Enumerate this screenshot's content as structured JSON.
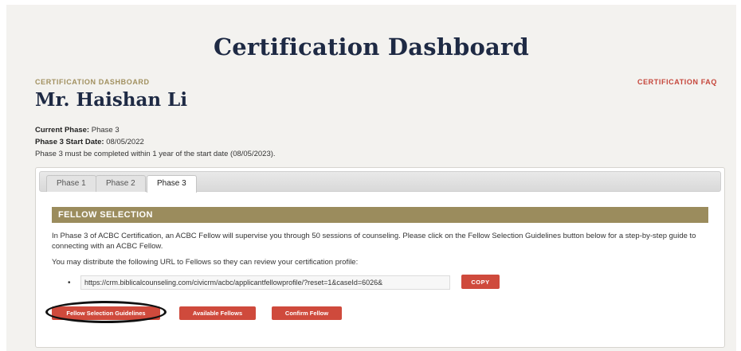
{
  "page": {
    "title": "Certification Dashboard",
    "breadcrumb": "CERTIFICATION DASHBOARD",
    "faq_link": "CERTIFICATION FAQ",
    "user_name": "Mr. Haishan Li"
  },
  "status": {
    "current_phase_label": "Current Phase:",
    "current_phase_value": "Phase 3",
    "start_date_label": "Phase 3 Start Date:",
    "start_date_value": "08/05/2022",
    "deadline_text": "Phase 3 must be completed within 1 year of the start date (08/05/2023)."
  },
  "tabs": [
    {
      "label": "Phase 1",
      "active": false
    },
    {
      "label": "Phase 2",
      "active": false
    },
    {
      "label": "Phase 3",
      "active": true
    }
  ],
  "fellow_section": {
    "header": "FELLOW SELECTION",
    "description": "In Phase 3 of ACBC Certification, an ACBC Fellow will supervise you through 50 sessions of counseling. Please click on the Fellow Selection Guidelines button below for a step-by-step guide to connecting with an ACBC Fellow.",
    "url_intro": "You may distribute the following URL to Fellows so they can review your certification profile:",
    "profile_url": "https://crm.biblicalcounseling.com/civicrm/acbc/applicantfellowprofile/?reset=1&caseId=6026&",
    "copy_label": "COPY",
    "buttons": {
      "guidelines": "Fellow Selection Guidelines",
      "available": "Available Fellows",
      "confirm": "Confirm Fellow"
    }
  },
  "colors": {
    "navy": "#1e2a44",
    "gold": "#9b8c5d",
    "accent_red": "#cf4a3c"
  }
}
